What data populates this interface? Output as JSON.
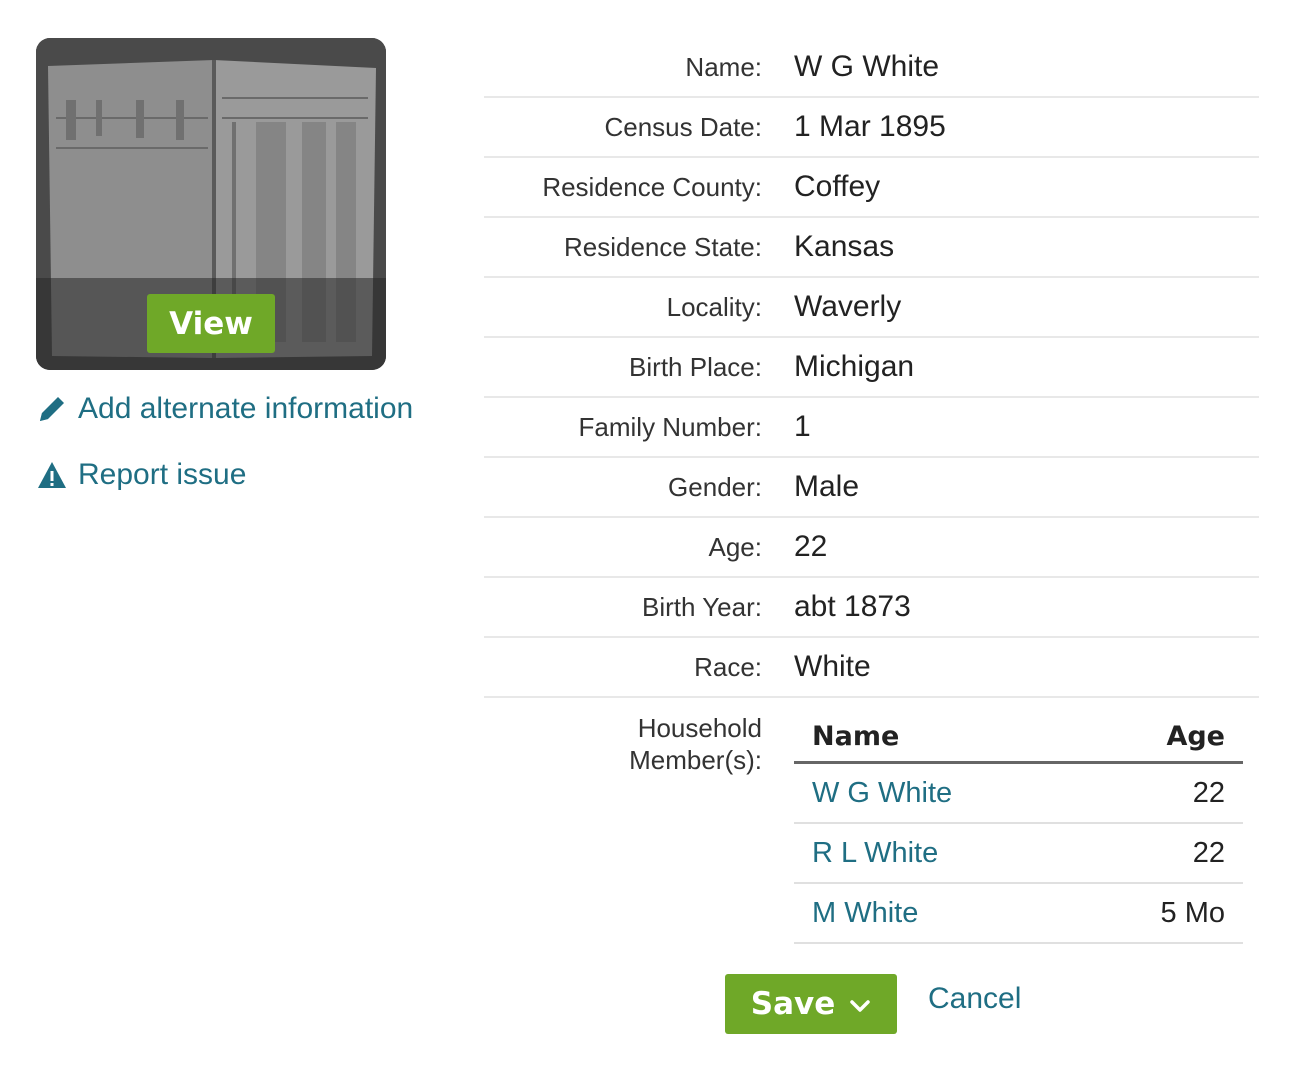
{
  "thumbnail": {
    "view_label": "View"
  },
  "actions": {
    "add_alt_label": "Add alternate information",
    "report_label": "Report issue"
  },
  "record": {
    "fields": [
      {
        "label": "Name:",
        "value": "W G White"
      },
      {
        "label": "Census Date:",
        "value": "1 Mar 1895"
      },
      {
        "label": "Residence County:",
        "value": "Coffey"
      },
      {
        "label": "Residence State:",
        "value": "Kansas"
      },
      {
        "label": "Locality:",
        "value": "Waverly"
      },
      {
        "label": "Birth Place:",
        "value": "Michigan"
      },
      {
        "label": "Family Number:",
        "value": "1"
      },
      {
        "label": "Gender:",
        "value": "Male"
      },
      {
        "label": "Age:",
        "value": "22"
      },
      {
        "label": "Birth Year:",
        "value": "abt 1873"
      },
      {
        "label": "Race:",
        "value": "White"
      }
    ]
  },
  "household": {
    "label_line1": "Household",
    "label_line2": "Member(s):",
    "col_name": "Name",
    "col_age": "Age",
    "members": [
      {
        "name": "W G White",
        "age": "22"
      },
      {
        "name": "R L White",
        "age": "22"
      },
      {
        "name": "M White",
        "age": "5 Mo"
      }
    ]
  },
  "footer": {
    "save_label": "Save",
    "cancel_label": "Cancel"
  },
  "colors": {
    "accent_green": "#6fa828",
    "link_teal": "#1f6e83"
  }
}
